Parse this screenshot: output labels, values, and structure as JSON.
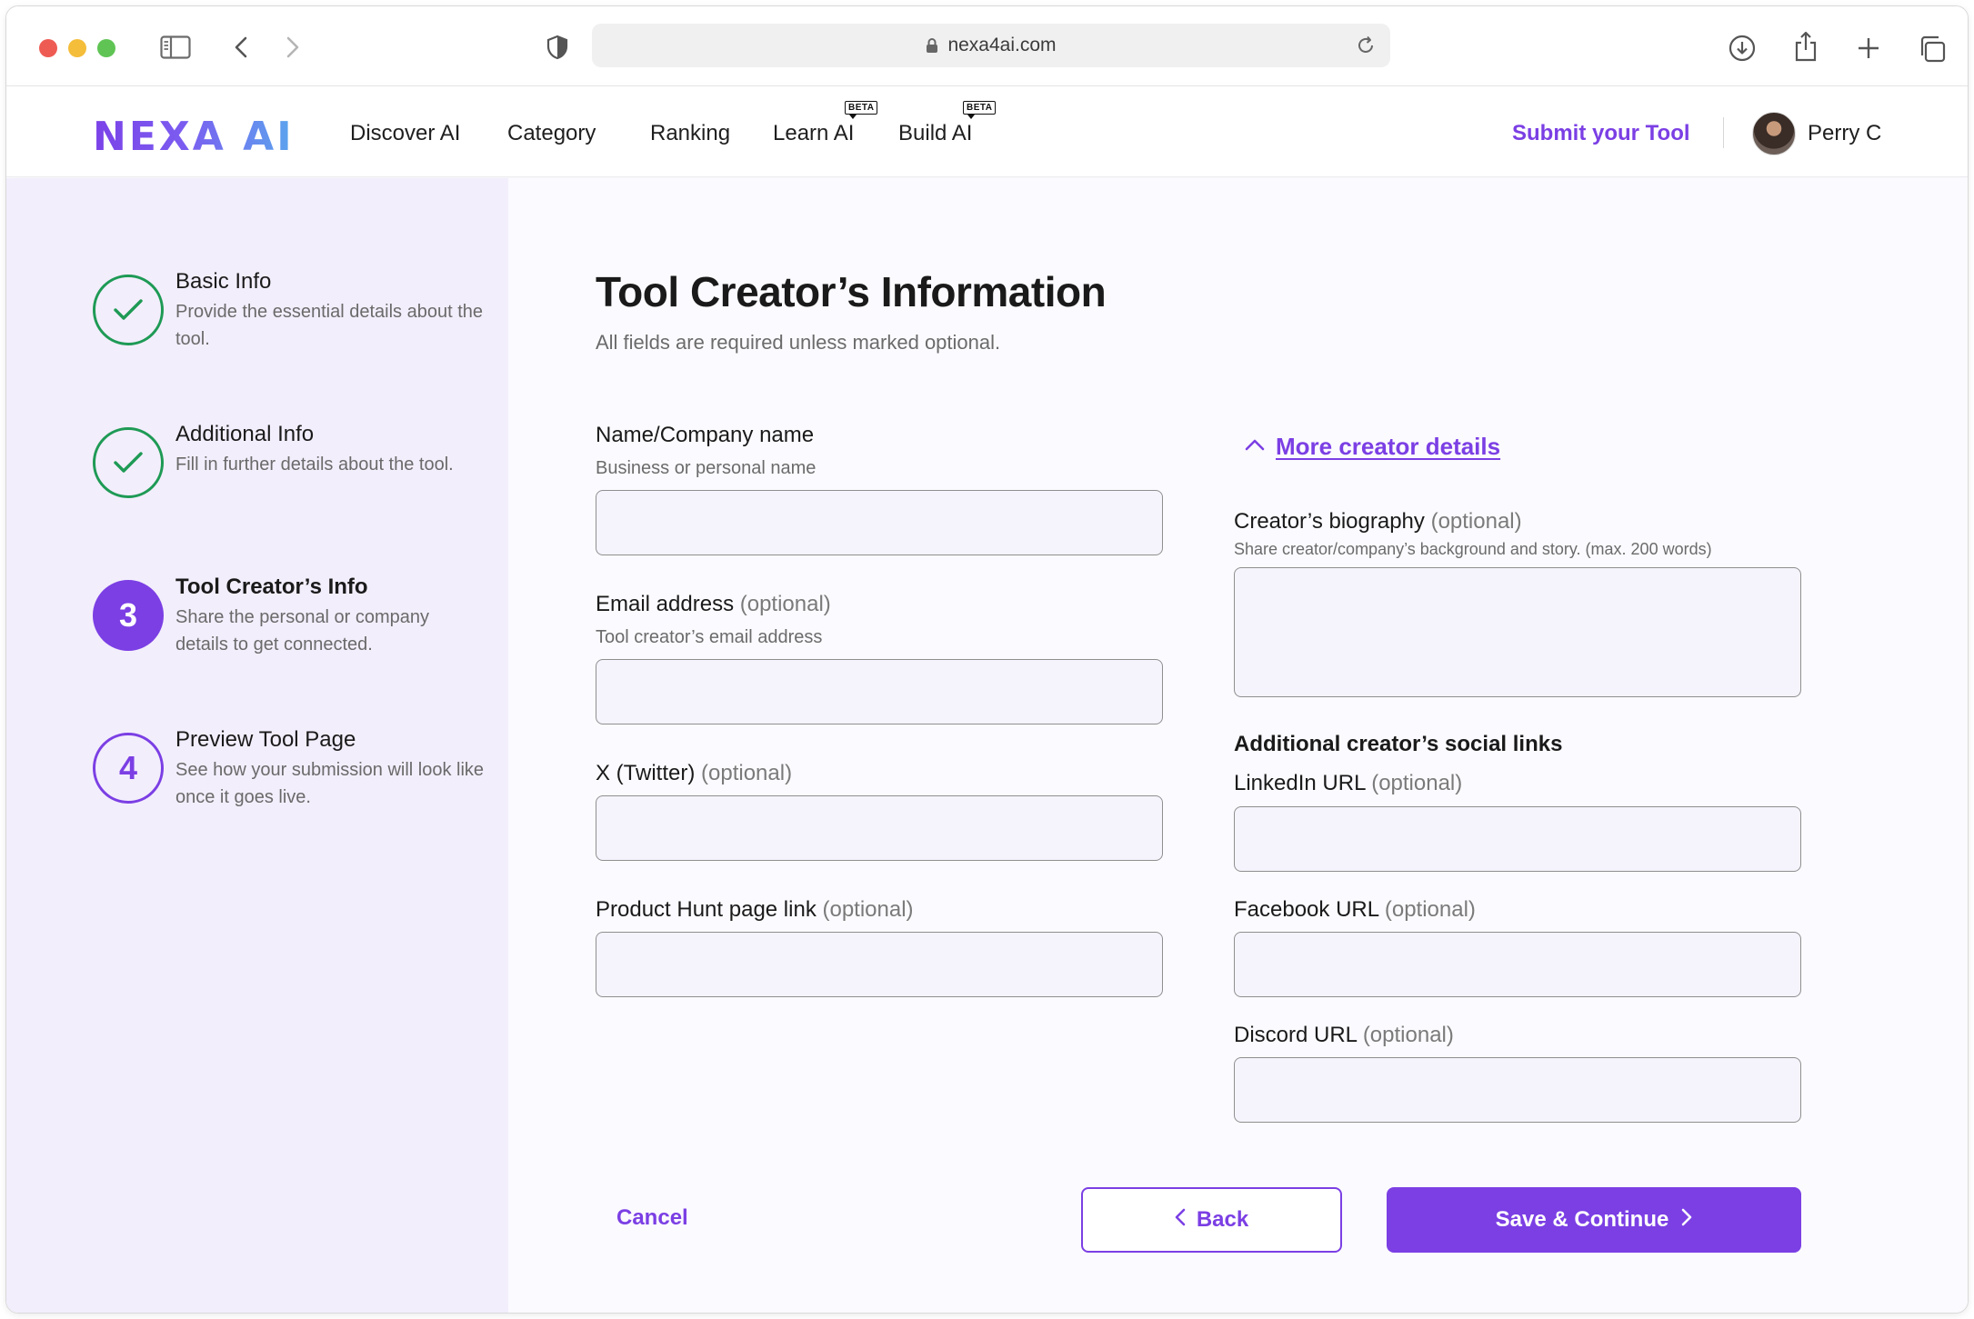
{
  "browser": {
    "url": "nexa4ai.com"
  },
  "nav": {
    "logo": "NEXA AI",
    "links": [
      "Discover AI",
      "Category",
      "Ranking",
      "Learn AI",
      "Build AI"
    ],
    "beta_badge": "BETA",
    "submit_label": "Submit your Tool",
    "user_name": "Perry C"
  },
  "steps": [
    {
      "number": "1",
      "title": "Basic Info",
      "desc": "Provide the essential details about the tool.",
      "status": "done"
    },
    {
      "number": "2",
      "title": "Additional Info",
      "desc": "Fill in further details about the tool.",
      "status": "done"
    },
    {
      "number": "3",
      "title": "Tool Creator’s Info",
      "desc": "Share the personal or company details to get connected.",
      "status": "current"
    },
    {
      "number": "4",
      "title": "Preview Tool Page",
      "desc": "See how your submission will look like once it goes live.",
      "status": "todo"
    }
  ],
  "form": {
    "title": "Tool Creator’s Information",
    "subtitle": "All fields are required unless marked optional.",
    "optional_tag": "(optional)",
    "name": {
      "label": "Name/Company name",
      "help": "Business or personal name",
      "value": ""
    },
    "email": {
      "label": "Email address",
      "help": "Tool creator’s email address",
      "value": ""
    },
    "twitter": {
      "label": "X (Twitter)",
      "value": ""
    },
    "producthunt": {
      "label": "Product Hunt page link",
      "value": ""
    },
    "more_toggle": "More creator details",
    "biography": {
      "label": "Creator’s biography",
      "help": "Share creator/company’s background and story. (max. 200 words)",
      "value": ""
    },
    "social_heading": "Additional creator’s social links",
    "linkedin": {
      "label": "LinkedIn URL",
      "value": ""
    },
    "facebook": {
      "label": "Facebook URL",
      "value": ""
    },
    "discord": {
      "label": "Discord URL",
      "value": ""
    }
  },
  "actions": {
    "cancel": "Cancel",
    "back": "Back",
    "save": "Save & Continue"
  },
  "colors": {
    "accent": "#7b3fe4",
    "success": "#1e9a55",
    "sidebar_bg": "#f3eefc"
  }
}
